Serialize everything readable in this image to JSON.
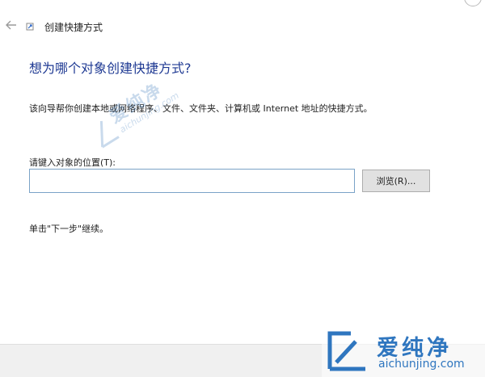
{
  "window": {
    "title": "创建快捷方式"
  },
  "wizard": {
    "heading": "想为哪个对象创建快捷方式?",
    "description": "该向导帮你创建本地或网络程序、文件、文件夹、计算机或 Internet 地址的快捷方式。",
    "location_label": "请键入对象的位置(T):",
    "location_value": "",
    "browse_label": "浏览(R)...",
    "next_hint": "单击\"下一步\"继续。"
  },
  "watermark": {
    "brand_cn": "爱纯净",
    "brand_url": "aichunjing.com"
  },
  "colors": {
    "heading": "#1f3a93",
    "input_border": "#7aa3c7",
    "button_bg": "#e1e1e1",
    "footer_bg": "#f0f0f0",
    "watermark": "#2f76bf"
  },
  "icons": {
    "back": "back-arrow-icon",
    "wizard": "shortcut-wizard-icon"
  }
}
